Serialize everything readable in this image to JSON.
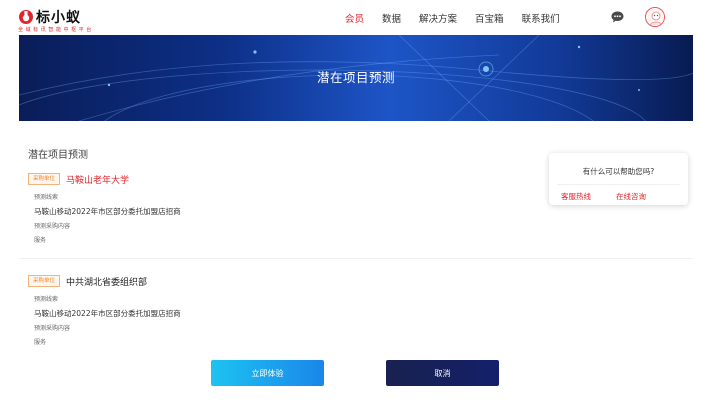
{
  "header": {
    "logo_text": "标小蚁",
    "logo_tagline": "全 域 标 讯 智 能 中 枢 平 台",
    "nav": [
      {
        "label": "会员",
        "active": true
      },
      {
        "label": "数据",
        "active": false
      },
      {
        "label": "解决方案",
        "active": false
      },
      {
        "label": "百宝箱",
        "active": false
      },
      {
        "label": "联系我们",
        "active": false
      }
    ]
  },
  "banner": {
    "title": "潜在项目预测"
  },
  "main": {
    "section_title": "潜在项目预测",
    "records": [
      {
        "badge": "采购单位",
        "org": "马鞍山老年大学",
        "clue_label": "预测线索",
        "clue": "马鞍山移动2022年市区部分委托加盟店招商",
        "content_label": "预测采购内容",
        "content": "服务"
      },
      {
        "badge": "采购单位",
        "org": "中共湖北省委组织部",
        "clue_label": "预测线索",
        "clue": "马鞍山移动2022年市区部分委托加盟店招商",
        "content_label": "预测采购内容",
        "content": "服务"
      }
    ]
  },
  "help": {
    "question": "有什么可以帮助您吗?",
    "hotline": "客服热线",
    "online": "在线咨询"
  },
  "actions": {
    "try_label": "立即体验",
    "cancel_label": "取消"
  },
  "colors": {
    "accent": "#e0252b",
    "badge": "#f08a2e",
    "try_button": "#1a9ff0",
    "cancel_button": "#17205c"
  }
}
